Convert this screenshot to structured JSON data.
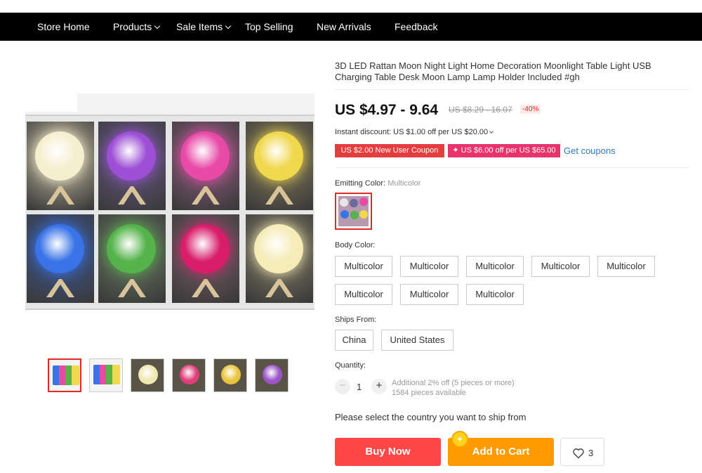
{
  "nav": {
    "items": [
      {
        "label": "Store Home",
        "dropdown": false
      },
      {
        "label": "Products",
        "dropdown": true
      },
      {
        "label": "Sale Items",
        "dropdown": true
      },
      {
        "label": "Top Selling",
        "dropdown": false
      },
      {
        "label": "New Arrivals",
        "dropdown": false
      },
      {
        "label": "Feedback",
        "dropdown": false
      }
    ]
  },
  "gallery": {
    "main_tiles": [
      {
        "color": "#f5efd0",
        "glow": "#c9c2a4"
      },
      {
        "color": "#9d4fd6",
        "glow": "#6b5a8e"
      },
      {
        "color": "#e84aa8",
        "glow": "#9a5f86"
      },
      {
        "color": "#f0d84c",
        "glow": "#8c825a"
      },
      {
        "color": "#3a73e8",
        "glow": "#3a5aa0"
      },
      {
        "color": "#54b34a",
        "glow": "#6b7f63"
      },
      {
        "color": "#d81d6b",
        "glow": "#7d5f6b"
      },
      {
        "color": "#f5ecb8",
        "glow": "#8a8468"
      }
    ],
    "thumbnails": [
      {
        "icon": "multicolor-grid",
        "color": "#9a7fbf",
        "selected": true
      },
      {
        "icon": "multicolor-row",
        "color": "#c7c7c7",
        "selected": false
      },
      {
        "icon": "moon-lamp",
        "color": "#efe7b0",
        "selected": false
      },
      {
        "icon": "moon-lamp",
        "color": "#e03e78",
        "selected": false
      },
      {
        "icon": "moon-lamp",
        "color": "#e9c33b",
        "selected": false
      },
      {
        "icon": "moon-lamp",
        "color": "#9b55c7",
        "selected": false
      }
    ]
  },
  "product": {
    "title": "3D LED Rattan Moon Night Light Home Decoration Moonlight Table Light USB Charging Table Desk Moon Lamp Lamp Holder Included #gh",
    "price": "US $4.97 - 9.64",
    "original_price": "US $8.29 - 16.07",
    "discount": "-40%",
    "instant_discount": "Instant discount: US $1.00 off per US $20.00",
    "coupon_new_user": "US $2.00 New User Coupon",
    "coupon_store": "✦ US $6.00 off per US $65.00",
    "get_coupons": "Get coupons"
  },
  "emitting_color": {
    "label": "Emitting Color:",
    "value": "Multicolor"
  },
  "body_color": {
    "label": "Body Color:",
    "options": [
      "Multicolor",
      "Multicolor",
      "Multicolor",
      "Multicolor",
      "Multicolor",
      "Multicolor",
      "Multicolor",
      "Multicolor"
    ]
  },
  "ships_from": {
    "label": "Ships From:",
    "options": [
      "China",
      "United States"
    ]
  },
  "quantity": {
    "label": "Quantity:",
    "minus": "−",
    "plus": "+",
    "value": "1",
    "additional": "Additional 2% off (5 pieces or more)",
    "available": "1584 pieces available"
  },
  "ship_message": "Please select the country you want to ship from",
  "actions": {
    "buy_now": "Buy Now",
    "add_to_cart": "Add to Cart",
    "wishlist_count": "3",
    "coin_icon": "✦"
  },
  "colors": {
    "accent_red": "#ff4747",
    "accent_orange": "#ff9a00",
    "link_blue": "#2e7bbd"
  }
}
